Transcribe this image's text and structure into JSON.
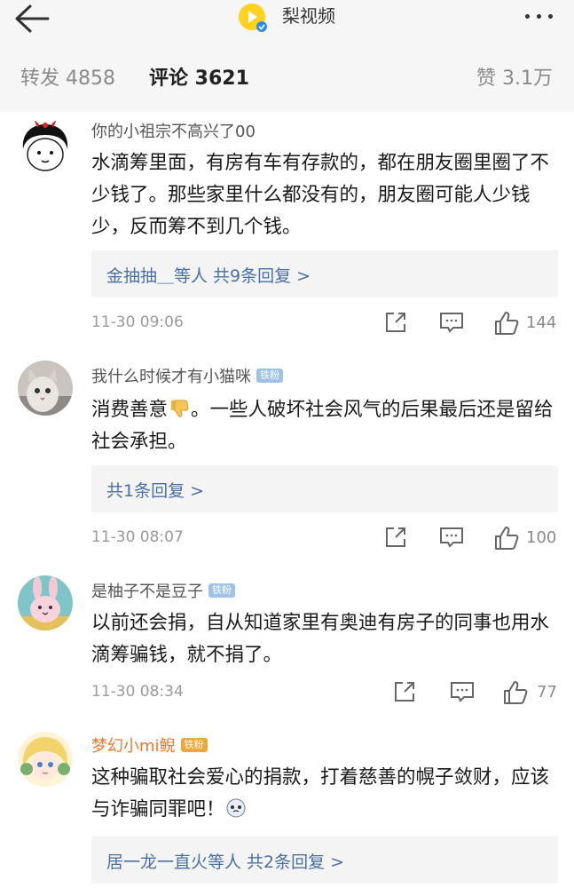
{
  "header": {
    "title": "梨视频",
    "back_icon": "back-arrow-icon",
    "more_icon": "more-dots-icon"
  },
  "tabs": {
    "repost": "转发 4858",
    "comment": "评论 3621",
    "like": "赞 3.1万"
  },
  "comments": [
    {
      "username": "你的小祖宗不高兴了00",
      "text": "水滴筹里面，有房有车有存款的，都在朋友圈里圈了不少钱了。那些家里什么都没有的，朋友圈可能人少钱少，反而筹不到几个钱。",
      "reply": "金抽抽＿等人 共9条回复 >",
      "time": "11-30 09:06",
      "likes": "144"
    },
    {
      "username": "我什么时候才有小猫咪",
      "badge": "铁粉",
      "text_before": "消费善意",
      "text_after": "。一些人破坏社会风气的后果最后还是留给社会承担。",
      "reply": "共1条回复 >",
      "time": "11-30 08:07",
      "likes": "100"
    },
    {
      "username": "是柚子不是豆子",
      "badge": "铁粉",
      "text": "以前还会捐，自从知道家里有奥迪有房子的同事也用水滴筹骗钱，就不捐了。",
      "time": "11-30 08:34",
      "likes": "77"
    },
    {
      "username": "梦幻小mi鲵",
      "badge": "铁粉",
      "text": "这种骗取社会爱心的捐款，打着慈善的幌子敛财，应该与诈骗同罪吧！",
      "reply": "居一龙一直火等人 共2条回复 >"
    }
  ],
  "colors": {
    "header_bg": "#f6f6f6",
    "reply_link": "#4a6fa5",
    "vip_name": "#e8792c",
    "badge": "#9fc3e8"
  }
}
